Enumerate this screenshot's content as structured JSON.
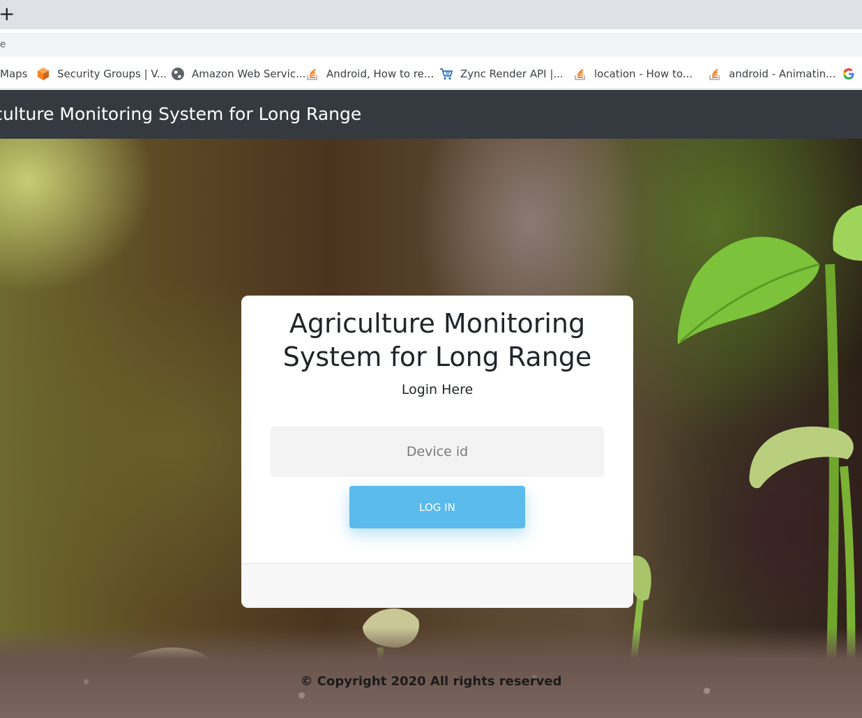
{
  "browser": {
    "new_tab_glyph": "+",
    "address_text": "e",
    "bookmarks": [
      {
        "label": "Maps",
        "icon": "maps-icon"
      },
      {
        "label": "Security Groups | V...",
        "icon": "aws-cube-icon"
      },
      {
        "label": "Amazon Web Servic...",
        "icon": "globe-icon"
      },
      {
        "label": "Android, How to re...",
        "icon": "stackoverflow-icon"
      },
      {
        "label": "Zync Render API |...",
        "icon": "cart-icon"
      },
      {
        "label": "location - How to...",
        "icon": "stackoverflow-icon"
      },
      {
        "label": "android - Animatin...",
        "icon": "stackoverflow-icon"
      },
      {
        "label": "",
        "icon": "google-icon"
      }
    ]
  },
  "navbar": {
    "brand": "Agriculture Monitoring System for Long Range"
  },
  "login": {
    "title": "Agriculture Monitoring System for Long Range",
    "subtitle": "Login Here",
    "device_placeholder": "Device id",
    "device_value": "",
    "login_button": "LOG IN"
  },
  "footer": {
    "copyright": "© Copyright 2020 All rights reserved"
  },
  "colors": {
    "navbar_bg": "#343a40",
    "button_bg": "#5bbbec",
    "card_bg": "#ffffff"
  }
}
